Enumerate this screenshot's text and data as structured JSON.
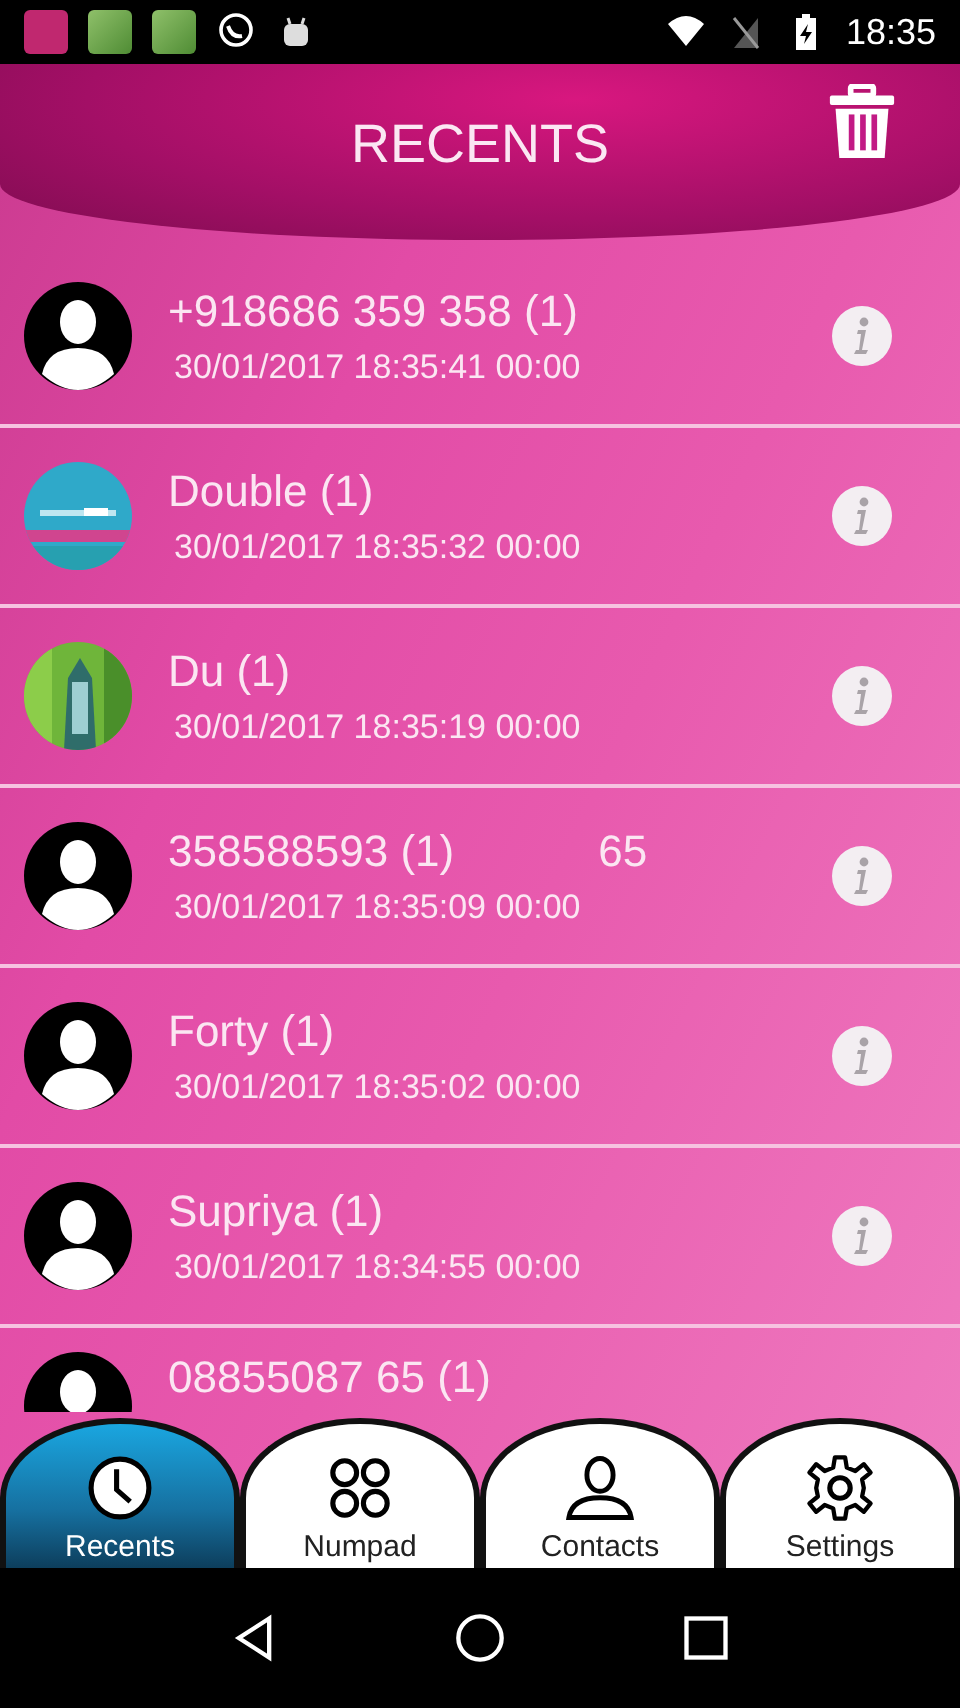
{
  "status_bar": {
    "time": "18:35"
  },
  "header": {
    "title": "RECENTS"
  },
  "calls": [
    {
      "name": "+918686 359 358 (1)",
      "detail": "30/01/2017 18:35:41 00:00",
      "kind": "contact"
    },
    {
      "name": "Double (1)",
      "detail": "30/01/2017 18:35:32 00:00",
      "kind": "picture"
    },
    {
      "name": "Du (1)",
      "detail": "30/01/2017 18:35:19 00:00",
      "kind": "picture"
    },
    {
      "name": "358588593 (1)",
      "overlay": "65",
      "detail": "30/01/2017 18:35:09 00:00",
      "kind": "contact"
    },
    {
      "name": "Forty (1)",
      "detail": "30/01/2017 18:35:02 00:00",
      "kind": "contact"
    },
    {
      "name": "Supriya (1)",
      "detail": "30/01/2017 18:34:55 00:00",
      "kind": "contact"
    },
    {
      "name": "08855087 65 (1)",
      "kind": "contact"
    }
  ],
  "tabs": [
    {
      "label": "Recents",
      "selected": true
    },
    {
      "label": "Numpad",
      "selected": false
    },
    {
      "label": "Contacts",
      "selected": false
    },
    {
      "label": "Settings",
      "selected": false
    }
  ]
}
